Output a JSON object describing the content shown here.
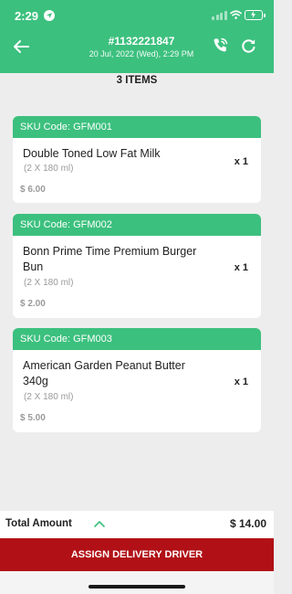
{
  "status_bar": {
    "time": "2:29"
  },
  "header": {
    "order_number": "#1132221847",
    "order_date": "20 Jul, 2022 (Wed),  2:29 PM",
    "icons": {
      "back": "arrow-left-icon",
      "call": "phone-call-icon",
      "refresh": "refresh-icon"
    }
  },
  "items_count_label": "3 ITEMS",
  "items": [
    {
      "sku": "SKU Code: GFM001",
      "name": "Double Toned Low Fat Milk",
      "pack": "(2 X 180 ml)",
      "price": "$ 6.00",
      "qty": "x 1"
    },
    {
      "sku": "SKU Code: GFM002",
      "name": "Bonn Prime Time Premium Burger Bun",
      "pack": "(2 X 180 ml)",
      "price": "$ 2.00",
      "qty": "x 1"
    },
    {
      "sku": "SKU Code: GFM003",
      "name": "American Garden Peanut Butter 340g",
      "pack": "(2 X 180 ml)",
      "price": "$ 5.00",
      "qty": "x 1"
    }
  ],
  "footer": {
    "total_label": "Total Amount",
    "total_value": "$ 14.00",
    "assign_label": "ASSIGN DELIVERY DRIVER"
  },
  "colors": {
    "primary": "#3cc07e",
    "action": "#b11116",
    "background": "#ededed"
  }
}
